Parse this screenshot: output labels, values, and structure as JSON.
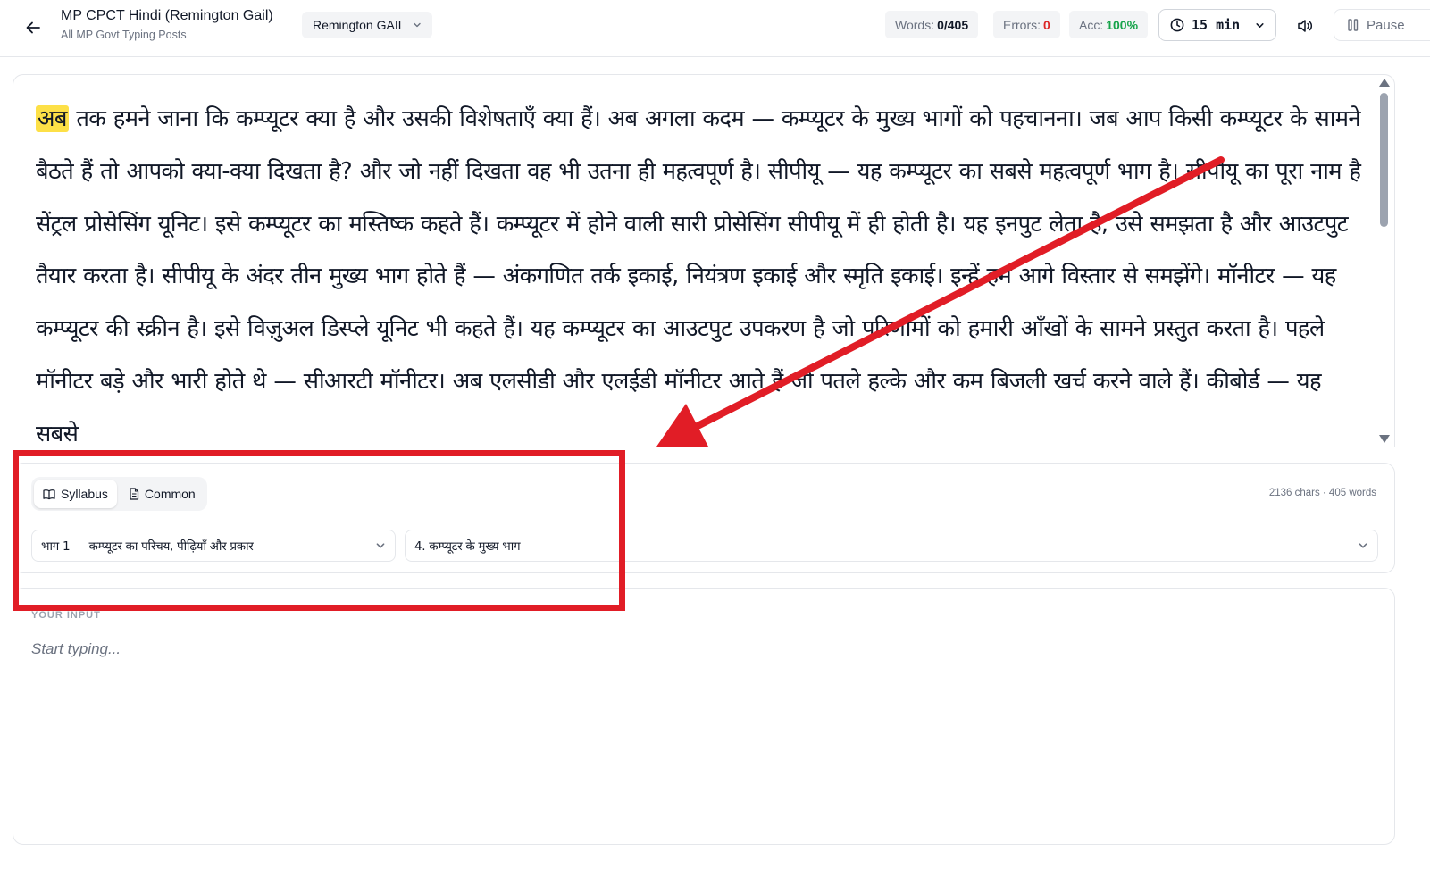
{
  "header": {
    "title": "MP CPCT Hindi (Remington Gail)",
    "subtitle": "All MP Govt Typing Posts",
    "layout_label": "Remington GAIL",
    "words_label": "Words:",
    "words_value": "0/405",
    "errors_label": "Errors:",
    "errors_value": "0",
    "acc_label": "Acc:",
    "acc_value": "100%",
    "timer_value": "15 min",
    "pause_label": "Pause"
  },
  "passage": {
    "current_word": "अब",
    "text": "तक हमने जाना कि कम्प्यूटर क्या है और उसकी विशेषताएँ क्या हैं। अब अगला कदम — कम्प्यूटर के मुख्य भागों को पहचानना। जब आप किसी कम्प्यूटर के सामने बैठते हैं तो आपको क्या-क्या दिखता है? और जो नहीं दिखता वह भी उतना ही महत्वपूर्ण है। सीपीयू — यह कम्प्यूटर का सबसे महत्वपूर्ण भाग है। सीपीयू का पूरा नाम है सेंट्रल प्रोसेसिंग यूनिट। इसे कम्प्यूटर का मस्तिष्क कहते हैं। कम्प्यूटर में होने वाली सारी प्रोसेसिंग सीपीयू में ही होती है। यह इनपुट लेता है, उसे समझता है और आउटपुट तैयार करता है। सीपीयू के अंदर तीन मुख्य भाग होते हैं — अंकगणित तर्क इकाई, नियंत्रण इकाई और स्मृति इकाई। इन्हें हम आगे विस्तार से समझेंगे। मॉनीटर — यह कम्प्यूटर की स्क्रीन है। इसे विज़ुअल डिस्प्ले यूनिट भी कहते हैं। यह कम्प्यूटर का आउटपुट उपकरण है जो परिणामों को हमारी आँखों के सामने प्रस्तुत करता है। पहले मॉनीटर बड़े और भारी होते थे — सीआरटी मॉनीटर। अब एलसीडी और एलईडी मॉनीटर आते हैं जो पतले हल्के और कम बिजली खर्च करने वाले हैं। कीबोर्ड — यह सबसे"
  },
  "source": {
    "tab_syllabus": "Syllabus",
    "tab_common": "Common",
    "count": "2136 chars · 405 words",
    "part_select": "भाग 1 — कम्प्यूटर का परिचय, पीढ़ियाँ और प्रकार",
    "topic_select": "4. कम्प्यूटर के मुख्य भाग"
  },
  "input": {
    "label": "YOUR INPUT",
    "placeholder": "Start typing..."
  },
  "colors": {
    "highlight": "#fde047",
    "error": "#dc2626",
    "accuracy": "#16a34a",
    "annotation": "#e11d26"
  },
  "icons": [
    "back-arrow-icon",
    "chevron-down-icon",
    "clock-icon",
    "speaker-icon",
    "pause-icon",
    "book-icon",
    "document-icon"
  ]
}
